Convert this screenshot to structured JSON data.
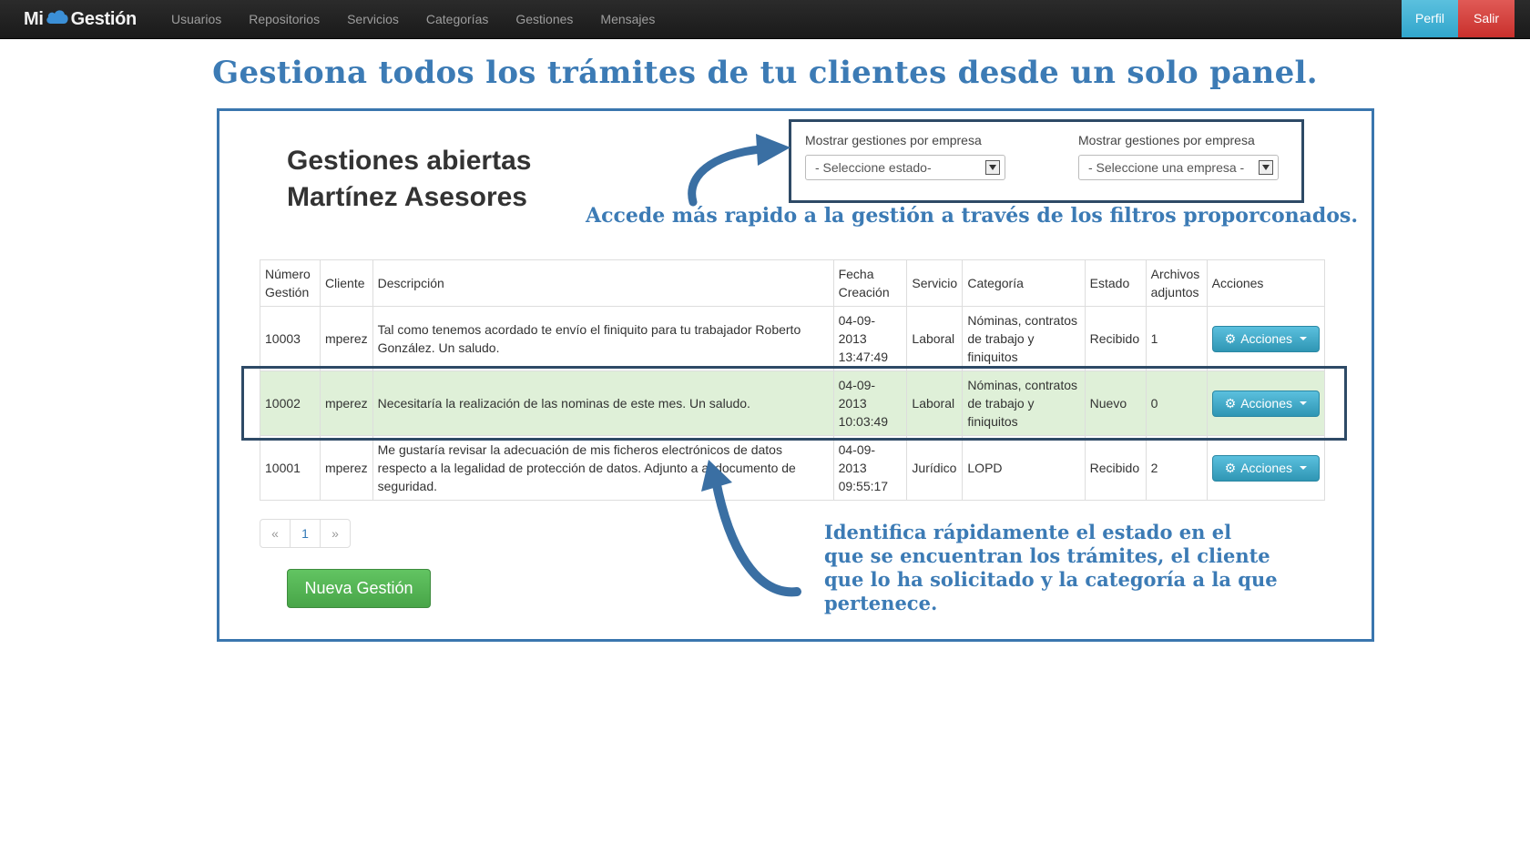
{
  "brand": {
    "prefix": "Mi",
    "suffix": "Gestión"
  },
  "nav": [
    "Usuarios",
    "Repositorios",
    "Servicios",
    "Categorías",
    "Gestiones",
    "Mensajes"
  ],
  "user_buttons": {
    "profile": "Perfil",
    "logout": "Salir"
  },
  "headline": "Gestiona todos los trámites de tu clientes desde un solo panel.",
  "page_title": {
    "line1": "Gestiones abiertas",
    "line2": "Martínez Asesores"
  },
  "filters": [
    {
      "label": "Mostrar gestiones por empresa",
      "value": "- Seleccione estado-"
    },
    {
      "label": "Mostrar gestiones por empresa",
      "value": "- Seleccione una empresa -"
    }
  ],
  "annotations": {
    "filters_note": "Accede más rapido a la gestión a través de los filtros proporconados.",
    "status_note": [
      "Identifica rápidamente el estado en el",
      "que se encuentran los trámites, el cliente",
      "que lo ha solicitado y la categoría a la que",
      "pertenece."
    ]
  },
  "table": {
    "headers": [
      "Número Gestión",
      "Cliente",
      "Descripción",
      "Fecha Creación",
      "Servicio",
      "Categoría",
      "Estado",
      "Archivos adjuntos",
      "Acciones"
    ],
    "rows": [
      {
        "numero": "10003",
        "cliente": "mperez",
        "descripcion": "Tal como tenemos acordado te envío el finiquito para tu trabajador Roberto González. Un saludo.",
        "fecha": "04-09-2013 13:47:49",
        "servicio": "Laboral",
        "categoria": "Nóminas, contratos de trabajo y finiquitos",
        "estado": "Recibido",
        "adjuntos": "1",
        "accion": "Acciones"
      },
      {
        "numero": "10002",
        "cliente": "mperez",
        "descripcion": "Necesitaría la realización de las nominas de este mes. Un saludo.",
        "fecha": "04-09-2013 10:03:49",
        "servicio": "Laboral",
        "categoria": "Nóminas, contratos de trabajo y finiquitos",
        "estado": "Nuevo",
        "adjuntos": "0",
        "accion": "Acciones"
      },
      {
        "numero": "10001",
        "cliente": "mperez",
        "descripcion": "Me gustaría revisar la adecuación de mis ficheros electrónicos de datos respecto a la legalidad de protección de datos. Adjunto a al documento de seguridad.",
        "fecha": "04-09-2013 09:55:17",
        "servicio": "Jurídico",
        "categoria": "LOPD",
        "estado": "Recibido",
        "adjuntos": "2",
        "accion": "Acciones"
      }
    ]
  },
  "pagination": {
    "prev": "«",
    "page": "1",
    "next": "»"
  },
  "new_button": "Nueva Gestión",
  "colors": {
    "accent": "#3c7bb5",
    "info": "#5bc0de",
    "danger": "#d9534f",
    "success": "#5cb85c",
    "highlight_row": "#dff0d8"
  }
}
